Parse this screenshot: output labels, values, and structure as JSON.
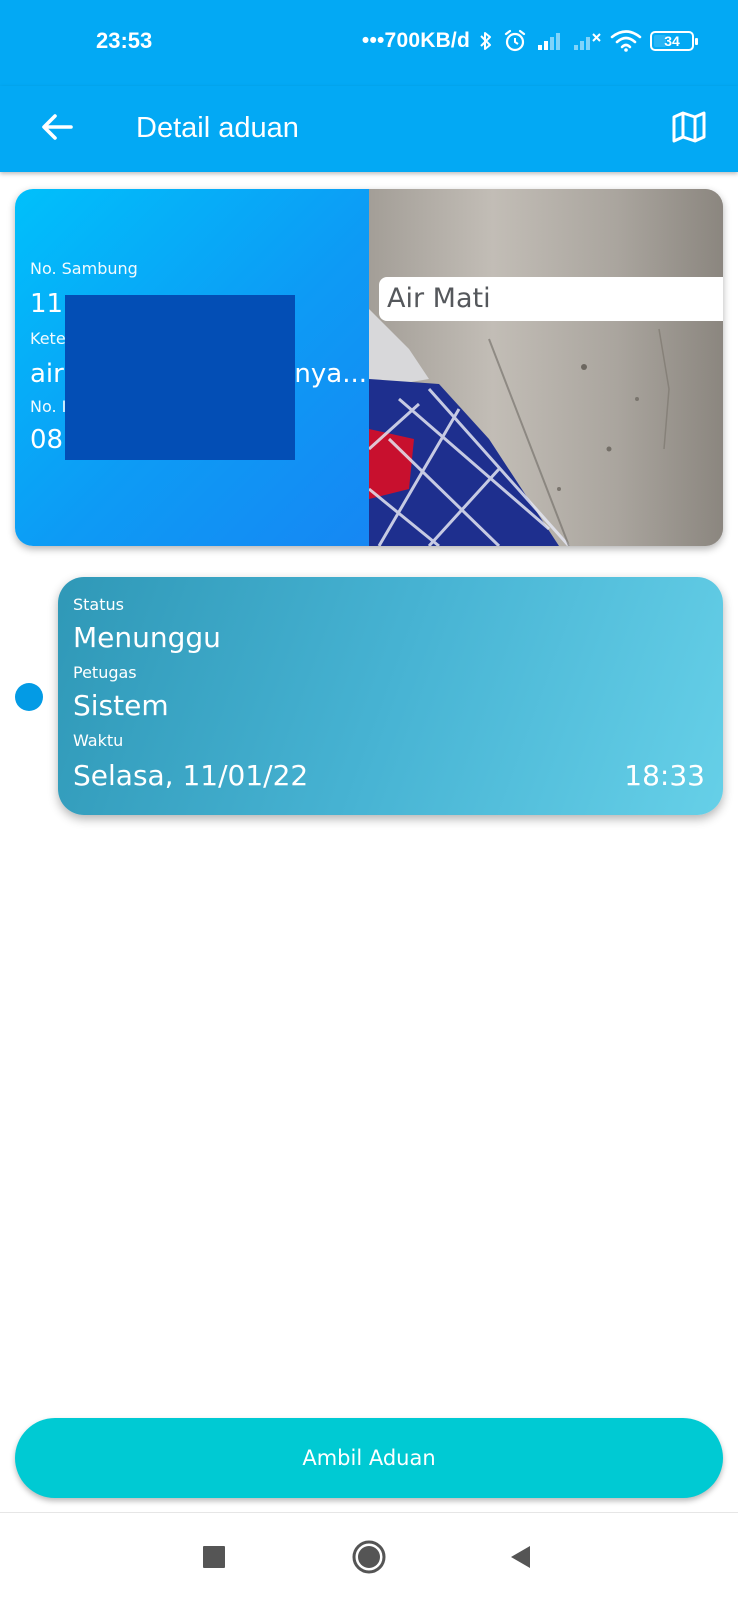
{
  "status_bar": {
    "time": "23:53",
    "network_speed": "•••700KB/d",
    "battery_level": "34",
    "icons": [
      "bluetooth-icon",
      "alarm-icon",
      "signal-icon",
      "signal-no-service-icon",
      "wifi-icon",
      "battery-icon"
    ]
  },
  "app_bar": {
    "title": "Detail aduan",
    "back_icon": "arrow-left-icon",
    "action_icon": "map-icon",
    "color": "#03a9f4"
  },
  "complaint": {
    "connection_label": "No. Sambung",
    "connection_value": "11",
    "description_label": "Kete",
    "description_value_start": "air",
    "description_value_end": "nya...",
    "phone_label": "No. I",
    "phone_value": "08",
    "category": "Air Mati"
  },
  "timeline": [
    {
      "status_label": "Status",
      "status_value": "Menunggu",
      "officer_label": "Petugas",
      "officer_value": "Sistem",
      "time_label": "Waktu",
      "date_value": "Selasa, 11/01/22",
      "time_value": "18:33"
    }
  ],
  "action_button": {
    "label": "Ambil Aduan",
    "color": "#00cad3"
  },
  "nav_bar": {
    "icons": [
      "recents-square-icon",
      "home-circle-icon",
      "back-triangle-icon"
    ]
  }
}
